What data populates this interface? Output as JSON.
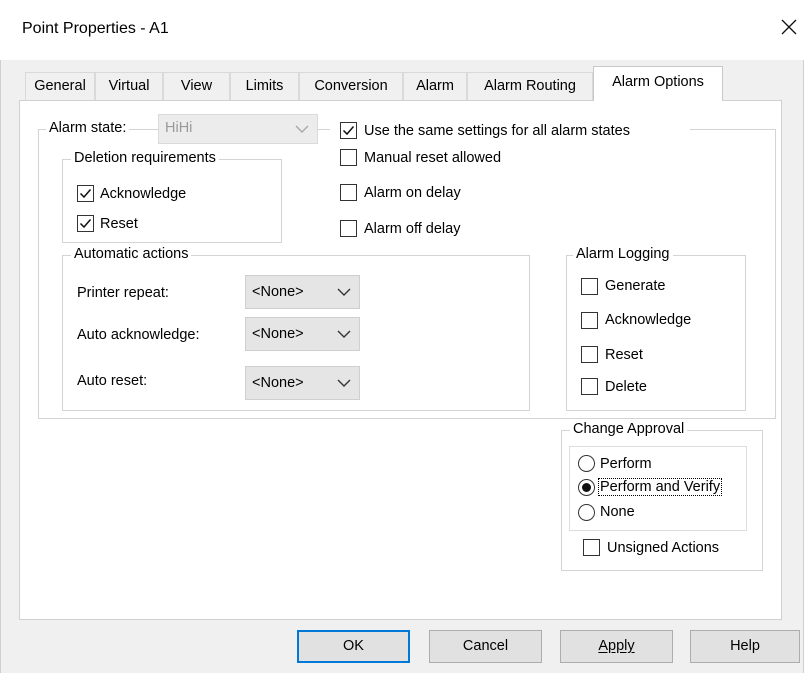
{
  "window": {
    "title": "Point Properties - A1"
  },
  "tabs": [
    {
      "label": "General"
    },
    {
      "label": "Virtual"
    },
    {
      "label": "View"
    },
    {
      "label": "Limits"
    },
    {
      "label": "Conversion"
    },
    {
      "label": "Alarm"
    },
    {
      "label": "Alarm Routing"
    },
    {
      "label": "Alarm Options",
      "active": true
    }
  ],
  "alarm_state": {
    "label": "Alarm state:",
    "value": "HiHi",
    "enabled": false
  },
  "same_settings": {
    "label": "Use the same settings for all alarm states",
    "checked": true
  },
  "deletion": {
    "title": "Deletion requirements",
    "acknowledge": {
      "label": "Acknowledge",
      "checked": true
    },
    "reset": {
      "label": "Reset",
      "checked": true
    }
  },
  "options": {
    "manual_reset": {
      "label": "Manual reset allowed",
      "checked": false
    },
    "alarm_on_delay": {
      "label": "Alarm on delay",
      "checked": false
    },
    "alarm_off_delay": {
      "label": "Alarm off delay",
      "checked": false
    }
  },
  "automatic_actions": {
    "title": "Automatic actions",
    "printer_repeat": {
      "label": "Printer repeat:",
      "value": "<None>"
    },
    "auto_acknowledge": {
      "label": "Auto acknowledge:",
      "value": "<None>"
    },
    "auto_reset": {
      "label": "Auto reset:",
      "value": "<None>"
    }
  },
  "alarm_logging": {
    "title": "Alarm Logging",
    "generate": {
      "label": "Generate",
      "checked": false
    },
    "acknowledge": {
      "label": "Acknowledge",
      "checked": false
    },
    "reset": {
      "label": "Reset",
      "checked": false
    },
    "delete": {
      "label": "Delete",
      "checked": false
    }
  },
  "change_approval": {
    "title": "Change Approval",
    "perform": {
      "label": "Perform",
      "selected": false
    },
    "perform_and_verify": {
      "label": "Perform and Verify",
      "selected": true
    },
    "none": {
      "label": "None",
      "selected": false
    },
    "unsigned_actions": {
      "label": "Unsigned Actions",
      "checked": false
    }
  },
  "buttons": {
    "ok": "OK",
    "cancel": "Cancel",
    "apply": "Apply",
    "help": "Help"
  },
  "colors": {
    "accent": "#0078d7",
    "dialog_bg": "#f0f0f0",
    "panel_bg": "#ffffff"
  }
}
